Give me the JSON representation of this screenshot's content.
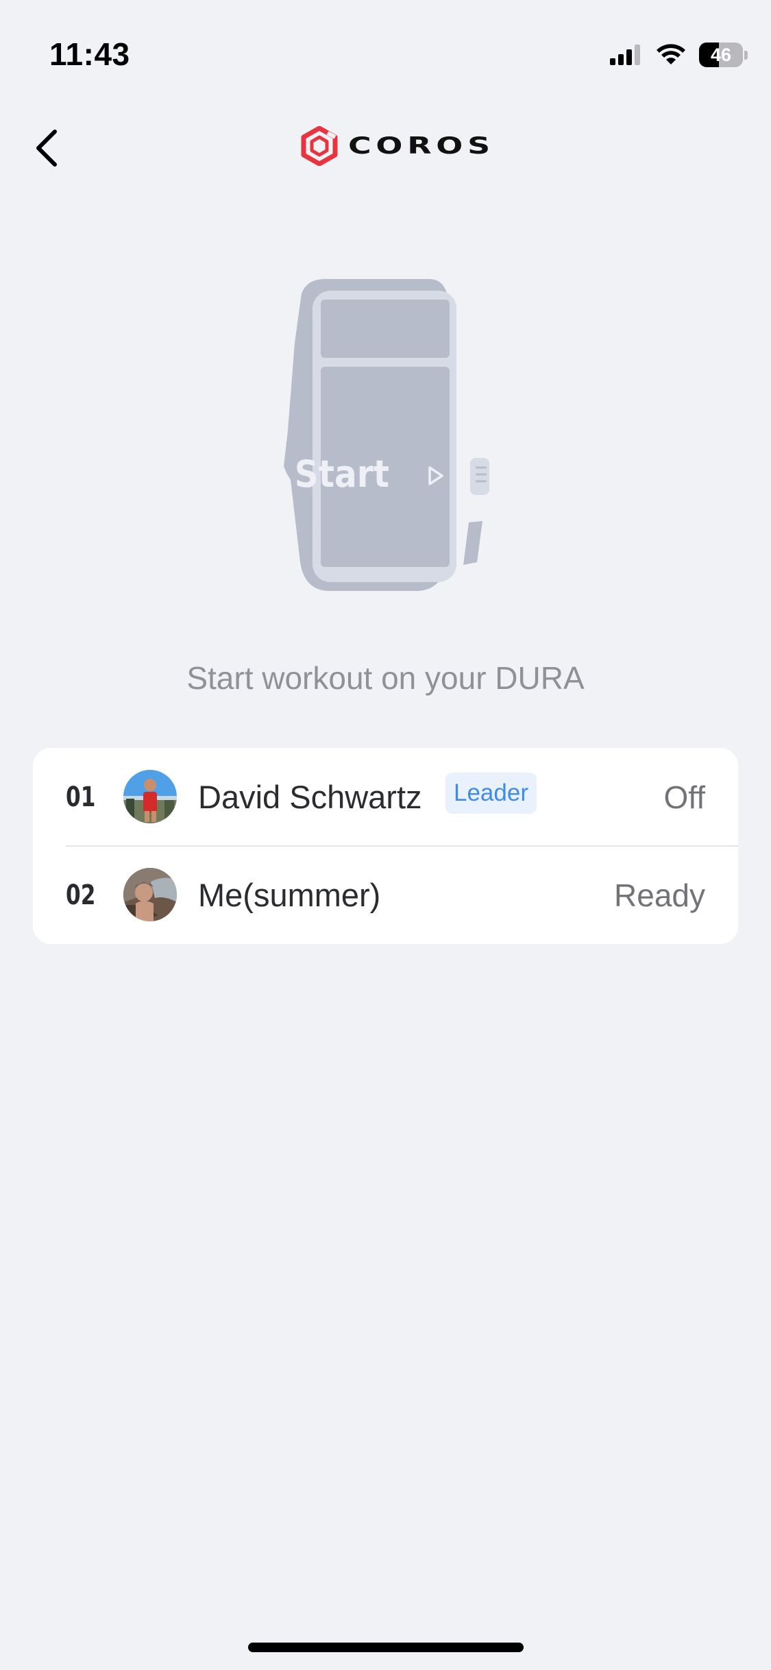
{
  "status_bar": {
    "time": "11:43",
    "battery_level": "46",
    "battery_fraction": 0.46,
    "icons": [
      "cellular-signal-icon",
      "wifi-icon",
      "battery-icon"
    ]
  },
  "header": {
    "back_icon": "chevron-left-icon",
    "brand_name": "COROS",
    "brand_color": "#e8343f"
  },
  "illustration": {
    "screen_label": "Start",
    "icon": "play-outline-icon"
  },
  "prompt": "Start workout on your DURA",
  "members": [
    {
      "index": "01",
      "name": "David Schwartz",
      "badge": "Leader",
      "status": "Off"
    },
    {
      "index": "02",
      "name": "Me(summer)",
      "status": "Ready"
    }
  ],
  "colors": {
    "background": "#f1f2f6",
    "badge_text": "#3f8be8",
    "badge_bg": "#e9f1fd",
    "muted_text": "#8f9197"
  }
}
